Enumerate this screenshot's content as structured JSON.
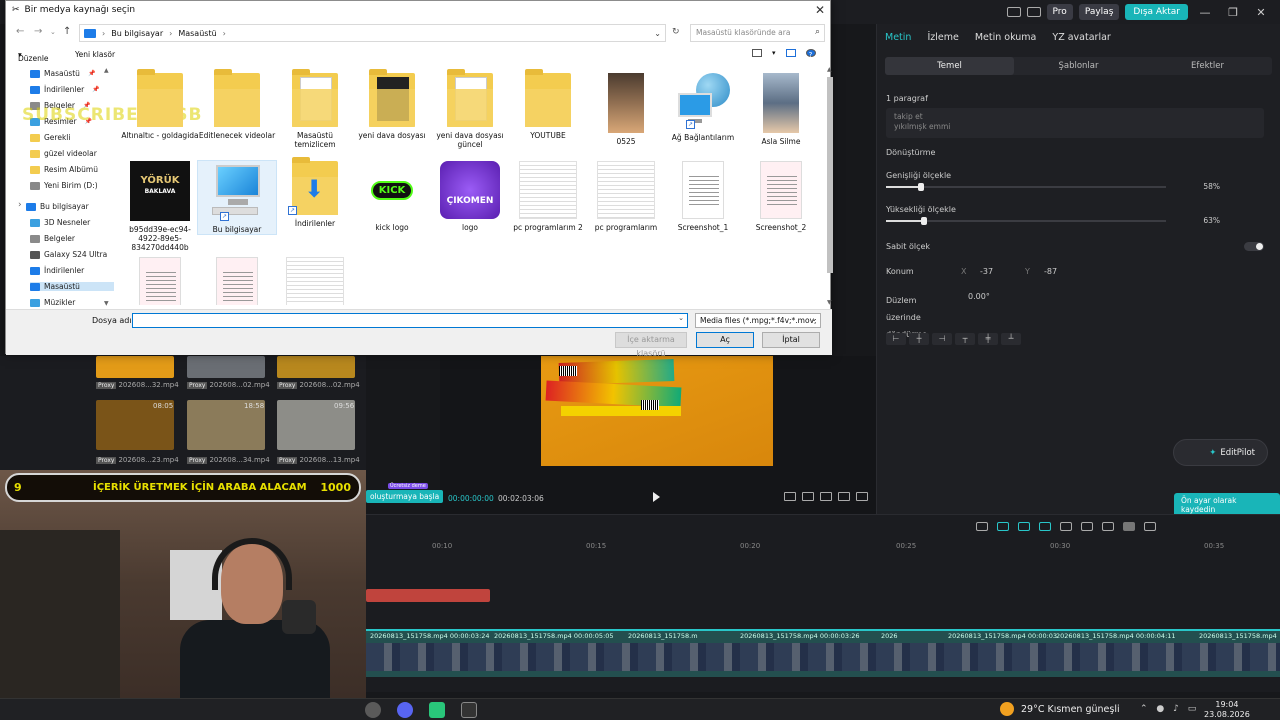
{
  "dialog": {
    "title": "Bir medya kaynağı seçin",
    "address": {
      "root": "Bu bilgisayar",
      "current": "Masaüstü"
    },
    "search_placeholder": "Masaüstü klasöründe ara",
    "toolbar": {
      "organize": "Düzenle",
      "new_folder": "Yeni klasör"
    },
    "nav_items": [
      {
        "label": "Masaüstü",
        "icon": "desktop-icon",
        "color": "#1d7ce8",
        "pinned": true
      },
      {
        "label": "İndirilenler",
        "icon": "download-icon",
        "color": "#1d7ce8",
        "pinned": true
      },
      {
        "label": "Belgeler",
        "icon": "documents-icon",
        "color": "#8a8a8a",
        "pinned": true
      },
      {
        "label": "Resimler",
        "icon": "pictures-icon",
        "color": "#3ba0e0",
        "pinned": true
      },
      {
        "label": "Gerekli",
        "icon": "folder-icon",
        "color": "#f3cc4f",
        "pinned": false
      },
      {
        "label": "güzel videolar",
        "icon": "folder-icon",
        "color": "#f3cc4f",
        "pinned": false
      },
      {
        "label": "Resim Albümü",
        "icon": "folder-icon",
        "color": "#f3cc4f",
        "pinned": false
      },
      {
        "label": "Yeni Birim (D:)",
        "icon": "drive-icon",
        "color": "#888888",
        "pinned": false
      },
      {
        "label": "Bu bilgisayar",
        "icon": "computer-icon",
        "color": "#1d7ce8",
        "pinned": false
      },
      {
        "label": "3D Nesneler",
        "icon": "3d-objects-icon",
        "color": "#3ba0e0",
        "pinned": false
      },
      {
        "label": "Belgeler",
        "icon": "documents-icon",
        "color": "#8a8a8a",
        "pinned": false
      },
      {
        "label": "Galaxy S24 Ultra",
        "icon": "phone-icon",
        "color": "#555555",
        "pinned": false
      },
      {
        "label": "İndirilenler",
        "icon": "download-icon",
        "color": "#1d7ce8",
        "pinned": false
      },
      {
        "label": "Masaüstü",
        "icon": "desktop-icon",
        "color": "#1d7ce8",
        "pinned": false
      },
      {
        "label": "Müzikler",
        "icon": "music-icon",
        "color": "#3ba0e0",
        "pinned": false
      }
    ],
    "watermark": "SUBSCRIBE : GSB",
    "files": [
      {
        "name": "Altınaltıc - goldagida",
        "kind": "folder"
      },
      {
        "name": "Editlenecek videolar",
        "kind": "folder"
      },
      {
        "name": "Masaüstü temizlicem",
        "kind": "folder-doc"
      },
      {
        "name": "yeni dava dosyası",
        "kind": "folder-dark"
      },
      {
        "name": "yeni dava dosyası güncel",
        "kind": "folder-doc"
      },
      {
        "name": "YOUTUBE",
        "kind": "folder"
      },
      {
        "name": "0525",
        "kind": "photo"
      },
      {
        "name": "Ağ Bağlantılarım",
        "kind": "network"
      },
      {
        "name": "Asla Silme",
        "kind": "photo2"
      },
      {
        "name": "b95dd39e-ec94-4922-89e5-834270dd440b",
        "kind": "yoruk"
      },
      {
        "name": "Bu bilgisayar",
        "kind": "computer"
      },
      {
        "name": "İndirilenler",
        "kind": "downloads"
      },
      {
        "name": "kick logo",
        "kind": "kick"
      },
      {
        "name": "logo",
        "kind": "cikomen"
      },
      {
        "name": "pc programlarım 2",
        "kind": "sheet"
      },
      {
        "name": "pc programlarım",
        "kind": "sheet"
      },
      {
        "name": "Screenshot_1",
        "kind": "page"
      },
      {
        "name": "Screenshot_2",
        "kind": "page2"
      },
      {
        "name": "",
        "kind": "page2"
      },
      {
        "name": "",
        "kind": "page2"
      },
      {
        "name": "",
        "kind": "sheet"
      }
    ],
    "file_name_label": "Dosya adı:",
    "file_name_value": "",
    "filter": "Media files (*.mpg;*.f4v;*.mov;",
    "import_folder_btn": "İçe aktarma klasörü",
    "open_btn": "Aç",
    "cancel_btn": "İptal",
    "yoruk_text": "YÖRÜK",
    "yoruk_sub": "BAKLAVA",
    "cikomen_text": "ÇIKOMEN",
    "kick_text": "KICK"
  },
  "editor": {
    "top": {
      "pro": "Pro",
      "share": "Paylaş",
      "export": "Dışa Aktar"
    },
    "right_tabs": [
      "Metin",
      "İzleme",
      "Metin okuma",
      "YZ avatarlar"
    ],
    "sub_tabs": [
      "Temel",
      "Şablonlar",
      "Efektler"
    ],
    "paragraph_label": "1 paragraf",
    "text_preview": "takip et\nyıkılmışk emmi",
    "transform_label": "Dönüştürme",
    "scale_w_label": "Genişliği ölçekle",
    "scale_w_value": "58%",
    "scale_w": 0.58,
    "scale_h_label": "Yüksekliği ölçekle",
    "scale_h_value": "63%",
    "scale_h": 0.63,
    "fixed_scale_label": "Sabit ölçek",
    "position_label": "Konum",
    "pos_x_label": "X",
    "pos_x": "-37",
    "pos_y_label": "Y",
    "pos_y": "-87",
    "rotation_label": "Düzlem üzerinde döndürme",
    "rotation_value": "0.00°",
    "editpilot": "EditPilot",
    "save_default": "Ön ayar olarak kaydedin",
    "time_current": "00:00:00:00",
    "time_total": "00:02:03:06",
    "teal_button": "oluşturmaya başla",
    "teal_badge": "Ücretsiz deme",
    "ruler_ticks": [
      "00:10",
      "00:15",
      "00:20",
      "00:25",
      "00:30",
      "00:35"
    ],
    "clip_labels": [
      "20260813_151758.mp4  00:00:03:24",
      "20260813_151758.mp4  00:00:05:05",
      "20260813_151758.m",
      "20260813_151758.mp4  00:00:03:26",
      "2026",
      "20260813_151758.mp4  00:00:03",
      "20260813_151758.mp4  00:00:04:11",
      "20260813_151758.mp4"
    ],
    "media": [
      {
        "label": "202608...32.mp4",
        "dur": ""
      },
      {
        "label": "202608...02.mp4",
        "dur": ""
      },
      {
        "label": "202608...02.mp4",
        "dur": ""
      },
      {
        "label": "202608...23.mp4",
        "dur": "08:05"
      },
      {
        "label": "202608...34.mp4",
        "dur": "18:58"
      },
      {
        "label": "202608...13.mp4",
        "dur": "09:56"
      }
    ],
    "proxy": "Proxy"
  },
  "webcam": {
    "banner_left": "9",
    "banner_text": "İÇERİK ÜRETMEK İÇİN ARABA ALACAM",
    "banner_right": "1000"
  },
  "taskbar": {
    "weather": "29°C  Kısmen güneşli",
    "time": "19:04",
    "date": "23.08.2026"
  }
}
